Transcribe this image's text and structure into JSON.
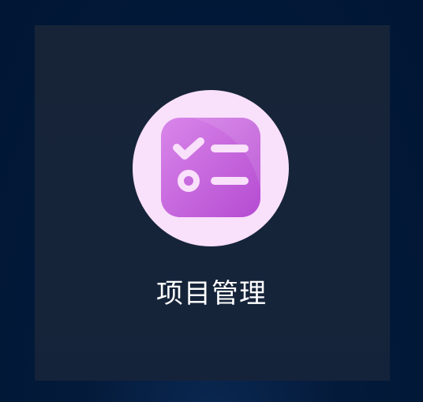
{
  "card": {
    "title": "项目管理",
    "icon": "task-checklist-icon"
  },
  "colors": {
    "background": "#001634",
    "card": "#172438",
    "icon_circle": "#f9e0fb",
    "icon_tile_top": "#d67de7",
    "icon_tile_bottom": "#b64ed3",
    "title_text": "#ffffff"
  }
}
